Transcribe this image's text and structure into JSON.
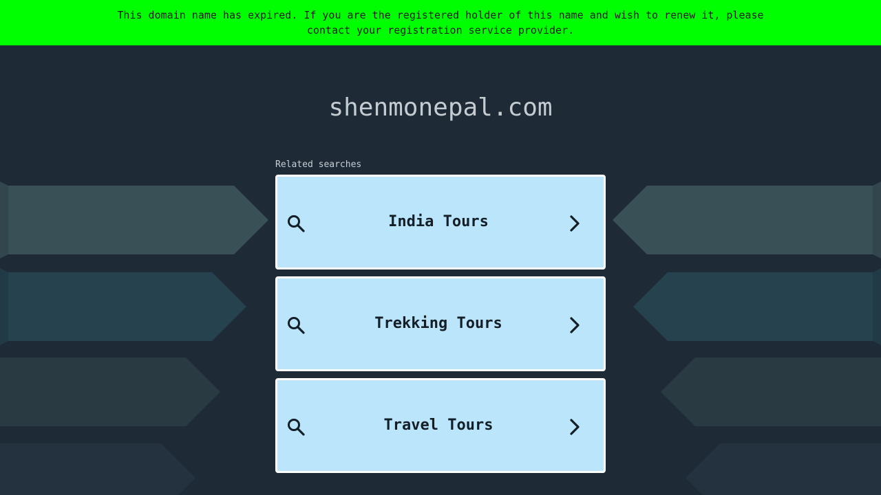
{
  "banner": {
    "line1": "This domain name has expired. If you are the registered holder of this name and wish to renew it, please",
    "line2": "contact your registration service provider."
  },
  "domain": "shenmonepal.com",
  "related_label": "Related searches",
  "results": [
    {
      "label": "India Tours"
    },
    {
      "label": "Trekking Tours"
    },
    {
      "label": "Travel Tours"
    }
  ],
  "colors": {
    "background": "#1e2a35",
    "banner": "#00ff00",
    "result_box": "#bae5fa"
  }
}
